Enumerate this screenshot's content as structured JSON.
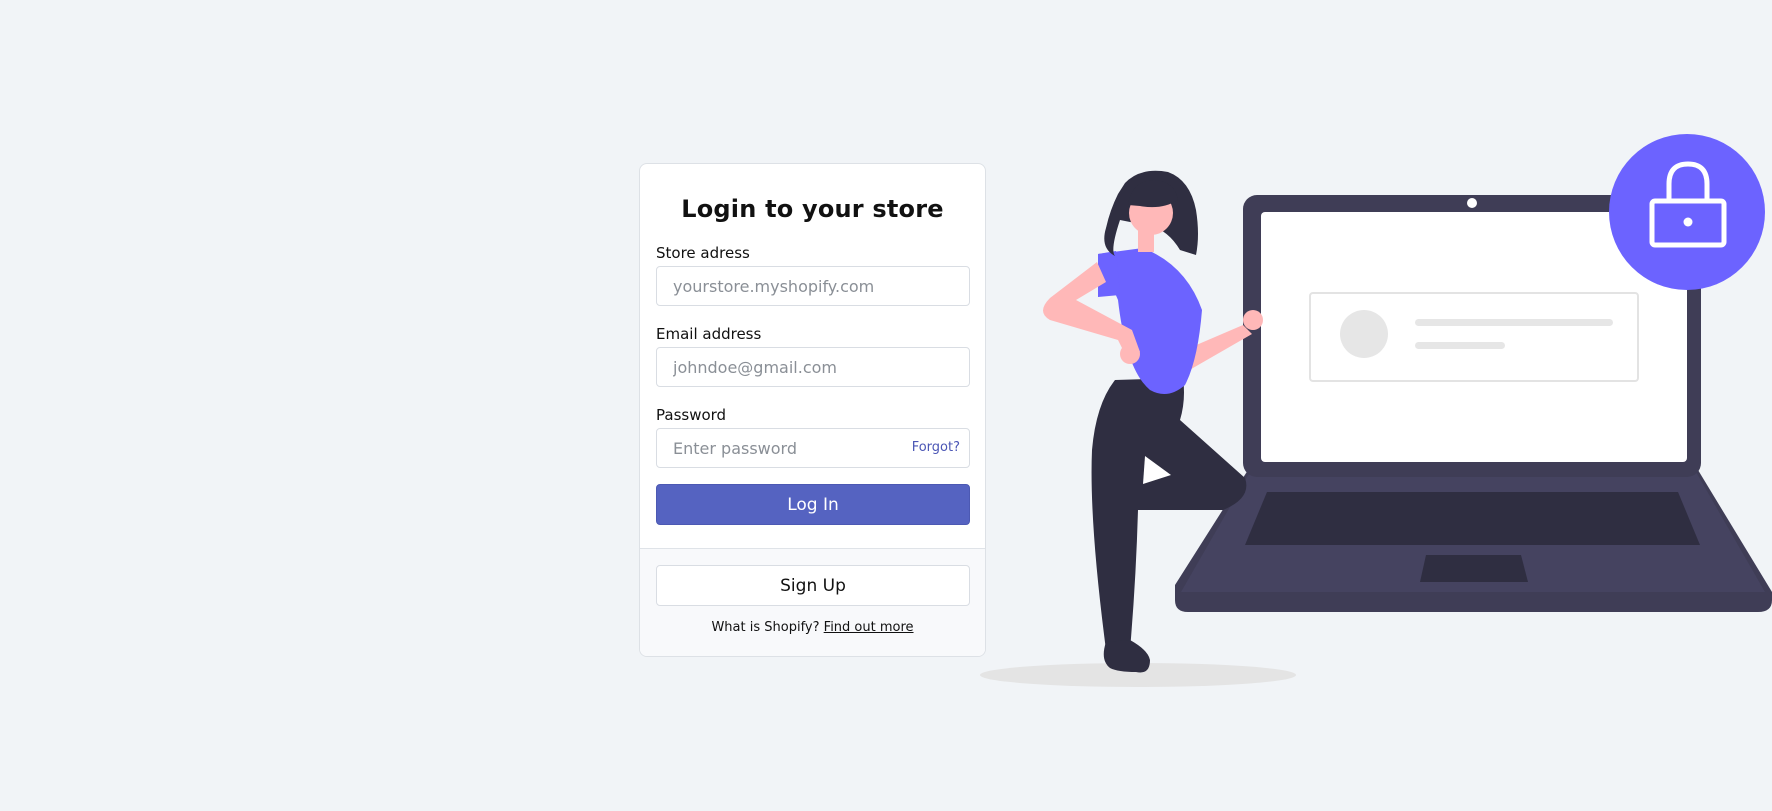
{
  "login": {
    "title": "Login to your store",
    "store": {
      "label": "Store adress",
      "placeholder": "yourstore.myshopify.com",
      "value": ""
    },
    "email": {
      "label": "Email address",
      "placeholder": "johndoe@gmail.com",
      "value": ""
    },
    "password": {
      "label": "Password",
      "placeholder": "Enter password",
      "value": "",
      "forgot_label": "Forgot?"
    },
    "login_button": "Log In",
    "signup_button": "Sign Up",
    "footer_prefix": "What is Shopify?",
    "footer_link": "Find out more"
  },
  "theme": {
    "accent": "#5563c1",
    "illustration_purple": "#6c63ff",
    "laptop_dark": "#3f3d56",
    "background": "#f1f4f7"
  },
  "icons": {
    "lock": "lock-icon"
  }
}
